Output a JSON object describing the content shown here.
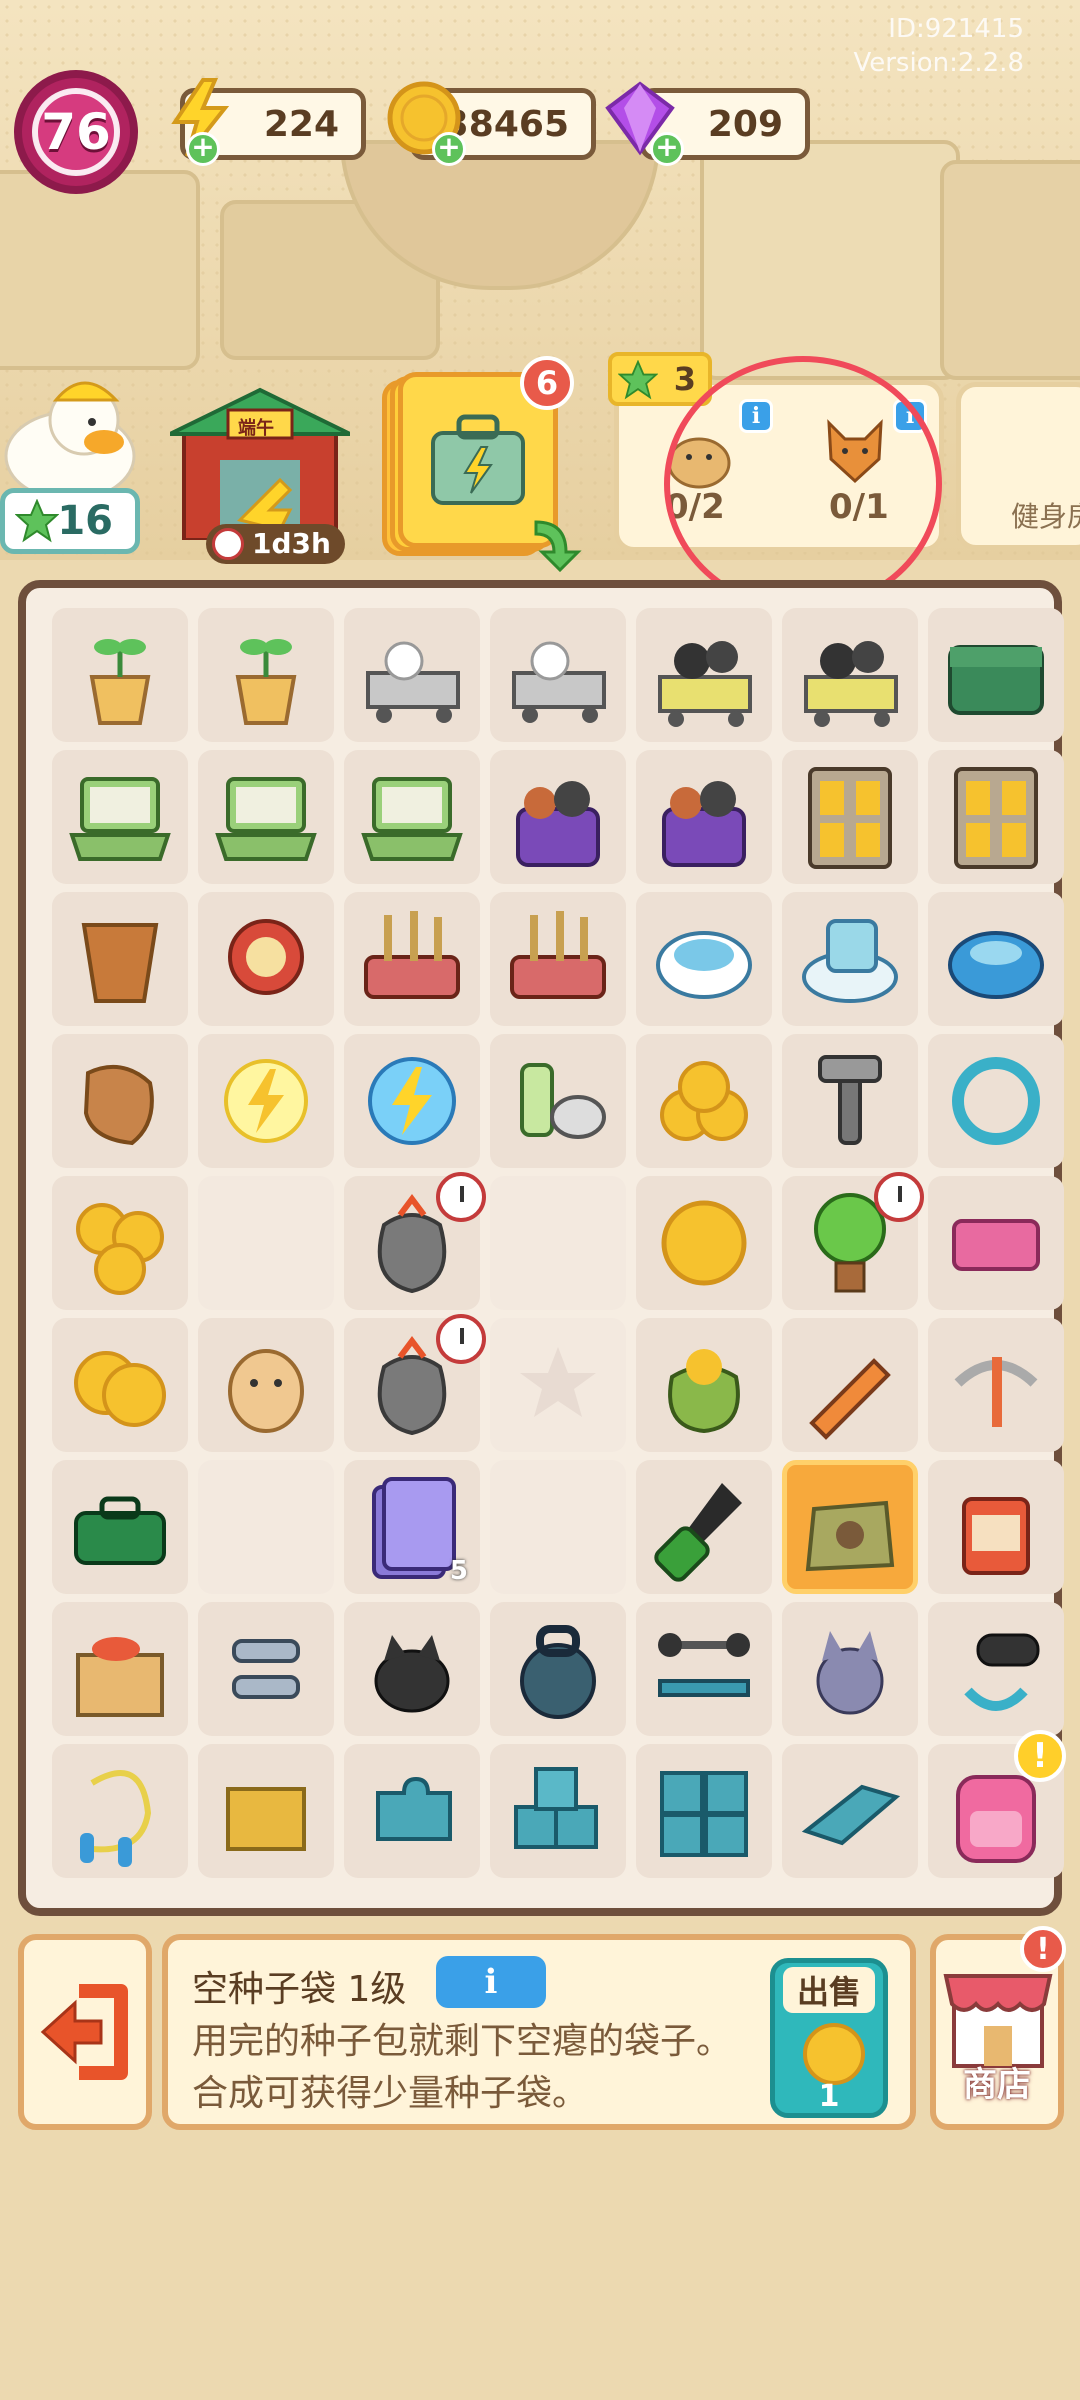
{
  "top_info": {
    "id": "ID:921415",
    "version": "Version:2.2.8"
  },
  "level": "76",
  "resources": {
    "energy": "224",
    "coins": "38465",
    "gems": "209"
  },
  "duck_stars": "16",
  "gate": {
    "sign": "端午",
    "timer": "1d3h"
  },
  "card_stack_count": "6",
  "goals": {
    "star_reward": "3",
    "goal1": "0/2",
    "goal2": "0/1"
  },
  "next_card_label": "健身房",
  "board": {
    "rows": [
      [
        "sprout-pot",
        "sprout-pot",
        "duck-cart",
        "duck-cart",
        "gear-cart",
        "gear-cart",
        "green-box"
      ],
      [
        "laptop",
        "laptop",
        "laptop",
        "purple-bag",
        "purple-bag",
        "locker",
        "locker"
      ],
      [
        "clay-pot",
        "scale-tool",
        "shovel-cart",
        "shovel-cart",
        "robot-vacuum",
        "robot-vacuum-lab",
        "robot-vacuum-blue"
      ],
      [
        "wood-chunk",
        "energy-small",
        "energy-bubble",
        "paint-cans",
        "coin-pile",
        "wrench",
        "ring"
      ],
      [
        "coin-stack",
        "",
        "seed-bag-timer",
        "",
        "coin",
        "flower-tree",
        "pink-brick"
      ],
      [
        "coin-double",
        "hamster",
        "seed-bag-timer",
        "star-slot",
        "coin-sack",
        "pencil",
        "pickaxe"
      ],
      [
        "toolbox",
        "",
        "card-pack",
        "",
        "screwdriver",
        "seed-bag-empty",
        "soup-can"
      ],
      [
        "paint-box",
        "exercise-grip",
        "black-cat",
        "kettlebell",
        "bench-press",
        "gray-cat",
        "foam-roller"
      ],
      [
        "jump-rope",
        "cardboard-box",
        "puzzle-blue",
        "blue-blocks",
        "puzzle-cluster",
        "puzzle-flat",
        "pink-backpack"
      ]
    ],
    "card_pack_count": "5",
    "selected": "seed-bag-empty"
  },
  "description": {
    "title": "空种子袋 1级",
    "info_label": "i",
    "text": "用完的种子包就剩下空瘪的袋子。合成可获得少量种子袋。",
    "sell_label": "出售",
    "sell_price": "1"
  },
  "shop_label": "商店",
  "annotation_color": "#f04a5a"
}
